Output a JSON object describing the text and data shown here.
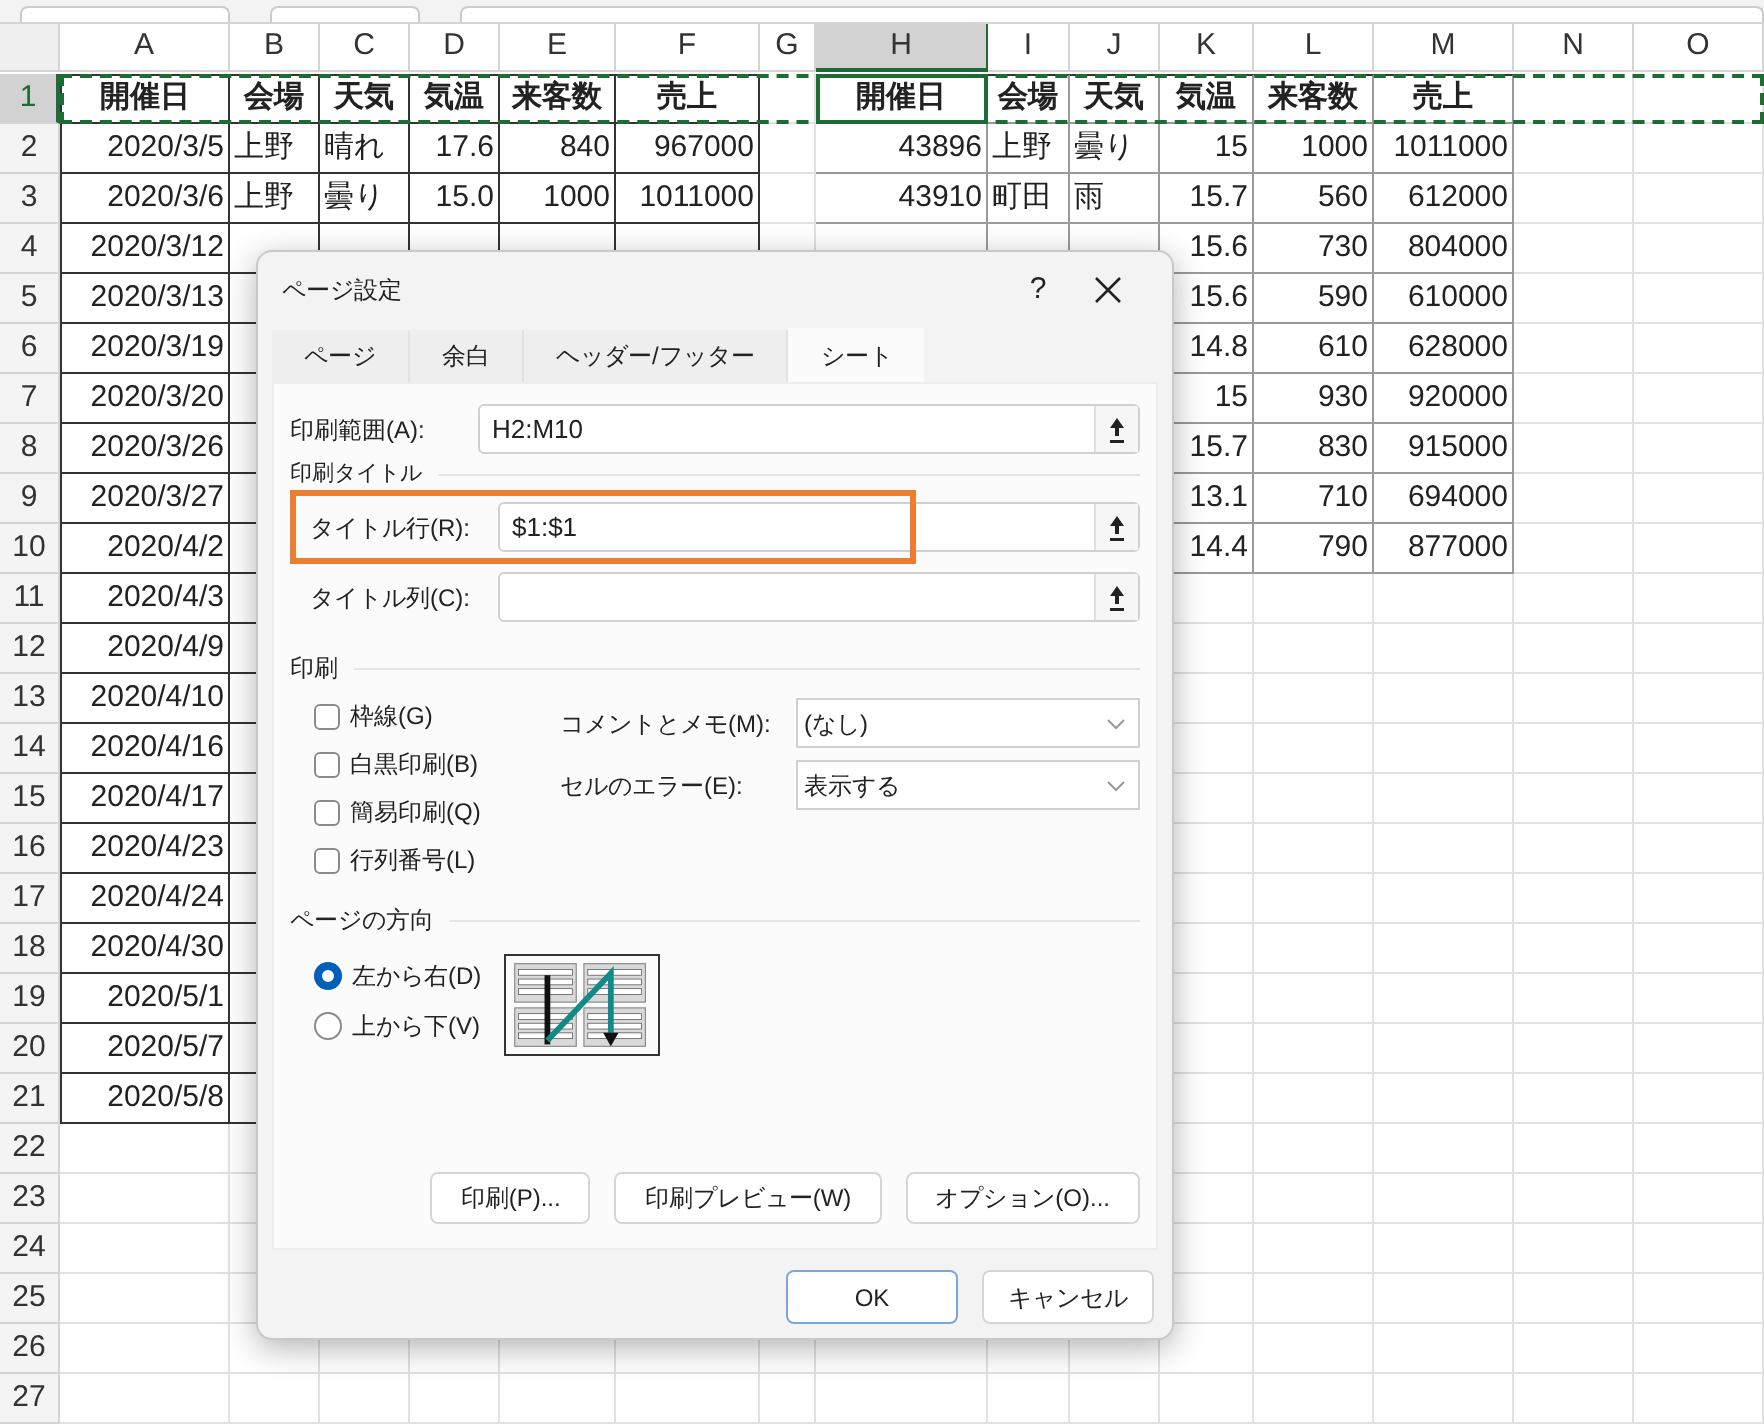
{
  "sheet": {
    "columns": [
      {
        "label": "A",
        "selected": false
      },
      {
        "label": "B",
        "selected": false
      },
      {
        "label": "C",
        "selected": false
      },
      {
        "label": "D",
        "selected": false
      },
      {
        "label": "E",
        "selected": false
      },
      {
        "label": "F",
        "selected": false
      },
      {
        "label": "G",
        "selected": false
      },
      {
        "label": "H",
        "selected": true
      },
      {
        "label": "I",
        "selected": false
      },
      {
        "label": "J",
        "selected": false
      },
      {
        "label": "K",
        "selected": false
      },
      {
        "label": "L",
        "selected": false
      },
      {
        "label": "M",
        "selected": false
      },
      {
        "label": "N",
        "selected": false
      },
      {
        "label": "O",
        "selected": false
      }
    ],
    "rows": [
      {
        "number": "1",
        "selected": true,
        "cells": {
          "A": "開催日",
          "B": "会場",
          "C": "天気",
          "D": "気温",
          "E": "来客数",
          "F": "売上",
          "H": "開催日",
          "I": "会場",
          "J": "天気",
          "K": "気温",
          "L": "来客数",
          "M": "売上"
        }
      },
      {
        "number": "2",
        "selected": false,
        "cells": {
          "A": "2020/3/5",
          "B": "上野",
          "C": "晴れ",
          "D": "17.6",
          "E": "840",
          "F": "967000",
          "H": "43896",
          "I": "上野",
          "J": "曇り",
          "K": "15",
          "L": "1000",
          "M": "1011000"
        }
      },
      {
        "number": "3",
        "selected": false,
        "cells": {
          "A": "2020/3/6",
          "B": "上野",
          "C": "曇り",
          "D": "15.0",
          "E": "1000",
          "F": "1011000",
          "H": "43910",
          "I": "町田",
          "J": "雨",
          "K": "15.7",
          "L": "560",
          "M": "612000"
        }
      },
      {
        "number": "4",
        "selected": false,
        "cells": {
          "A": "2020/3/12",
          "K": "15.6",
          "L": "730",
          "M": "804000"
        }
      },
      {
        "number": "5",
        "selected": false,
        "cells": {
          "A": "2020/3/13",
          "K": "15.6",
          "L": "590",
          "M": "610000"
        }
      },
      {
        "number": "6",
        "selected": false,
        "cells": {
          "A": "2020/3/19",
          "K": "14.8",
          "L": "610",
          "M": "628000"
        }
      },
      {
        "number": "7",
        "selected": false,
        "cells": {
          "A": "2020/3/20",
          "K": "15",
          "L": "930",
          "M": "920000"
        }
      },
      {
        "number": "8",
        "selected": false,
        "cells": {
          "A": "2020/3/26",
          "K": "15.7",
          "L": "830",
          "M": "915000"
        }
      },
      {
        "number": "9",
        "selected": false,
        "cells": {
          "A": "2020/3/27",
          "K": "13.1",
          "L": "710",
          "M": "694000"
        }
      },
      {
        "number": "10",
        "selected": false,
        "cells": {
          "A": "2020/4/2",
          "K": "14.4",
          "L": "790",
          "M": "877000"
        }
      },
      {
        "number": "11",
        "selected": false,
        "cells": {
          "A": "2020/4/3"
        }
      },
      {
        "number": "12",
        "selected": false,
        "cells": {
          "A": "2020/4/9"
        }
      },
      {
        "number": "13",
        "selected": false,
        "cells": {
          "A": "2020/4/10"
        }
      },
      {
        "number": "14",
        "selected": false,
        "cells": {
          "A": "2020/4/16"
        }
      },
      {
        "number": "15",
        "selected": false,
        "cells": {
          "A": "2020/4/17"
        }
      },
      {
        "number": "16",
        "selected": false,
        "cells": {
          "A": "2020/4/23"
        }
      },
      {
        "number": "17",
        "selected": false,
        "cells": {
          "A": "2020/4/24"
        }
      },
      {
        "number": "18",
        "selected": false,
        "cells": {
          "A": "2020/4/30"
        }
      },
      {
        "number": "19",
        "selected": false,
        "cells": {
          "A": "2020/5/1"
        }
      },
      {
        "number": "20",
        "selected": false,
        "cells": {
          "A": "2020/5/7"
        }
      },
      {
        "number": "21",
        "selected": false,
        "cells": {
          "A": "2020/5/8"
        }
      },
      {
        "number": "22",
        "selected": false
      },
      {
        "number": "23",
        "selected": false
      },
      {
        "number": "24",
        "selected": false
      },
      {
        "number": "25",
        "selected": false
      },
      {
        "number": "26",
        "selected": false
      },
      {
        "number": "27",
        "selected": false
      }
    ]
  },
  "dialog": {
    "title": "ページ設定",
    "help": "?",
    "tabs": [
      {
        "label": "ページ",
        "selected": false
      },
      {
        "label": "余白",
        "selected": false
      },
      {
        "label": "ヘッダー/フッター",
        "selected": false
      },
      {
        "label": "シート",
        "selected": true
      }
    ],
    "print_area": {
      "label": "印刷範囲(A):",
      "value": "H2:M10"
    },
    "print_titles": {
      "label": "印刷タイトル",
      "rows_label": "タイトル行(R):",
      "rows_value": "$1:$1",
      "highlighted": true,
      "columns_label": "タイトル列(C):"
    },
    "print": {
      "label": "印刷",
      "checkboxes": [
        {
          "label": "枠線(G)",
          "checked": false
        },
        {
          "label": "白黒印刷(B)",
          "checked": false
        },
        {
          "label": "簡易印刷(Q)",
          "checked": false
        },
        {
          "label": "行列番号(L)",
          "checked": false
        }
      ],
      "dropdowns": [
        {
          "label": "コメントとメモ(M):",
          "value": "(なし)"
        },
        {
          "label": "セルのエラー(E):",
          "value": "表示する"
        }
      ]
    },
    "page_order": {
      "label": "ページの方向",
      "options": [
        {
          "label": "左から右(D)",
          "selected": true
        },
        {
          "label": "上から下(V)",
          "selected": false
        }
      ]
    },
    "buttons": [
      "印刷(P)...",
      "印刷プレビュー(W)",
      "オプション(O)..."
    ],
    "footer_buttons": [
      {
        "label": "OK",
        "default": true
      },
      {
        "label": "キャンセル",
        "default": false
      }
    ]
  }
}
